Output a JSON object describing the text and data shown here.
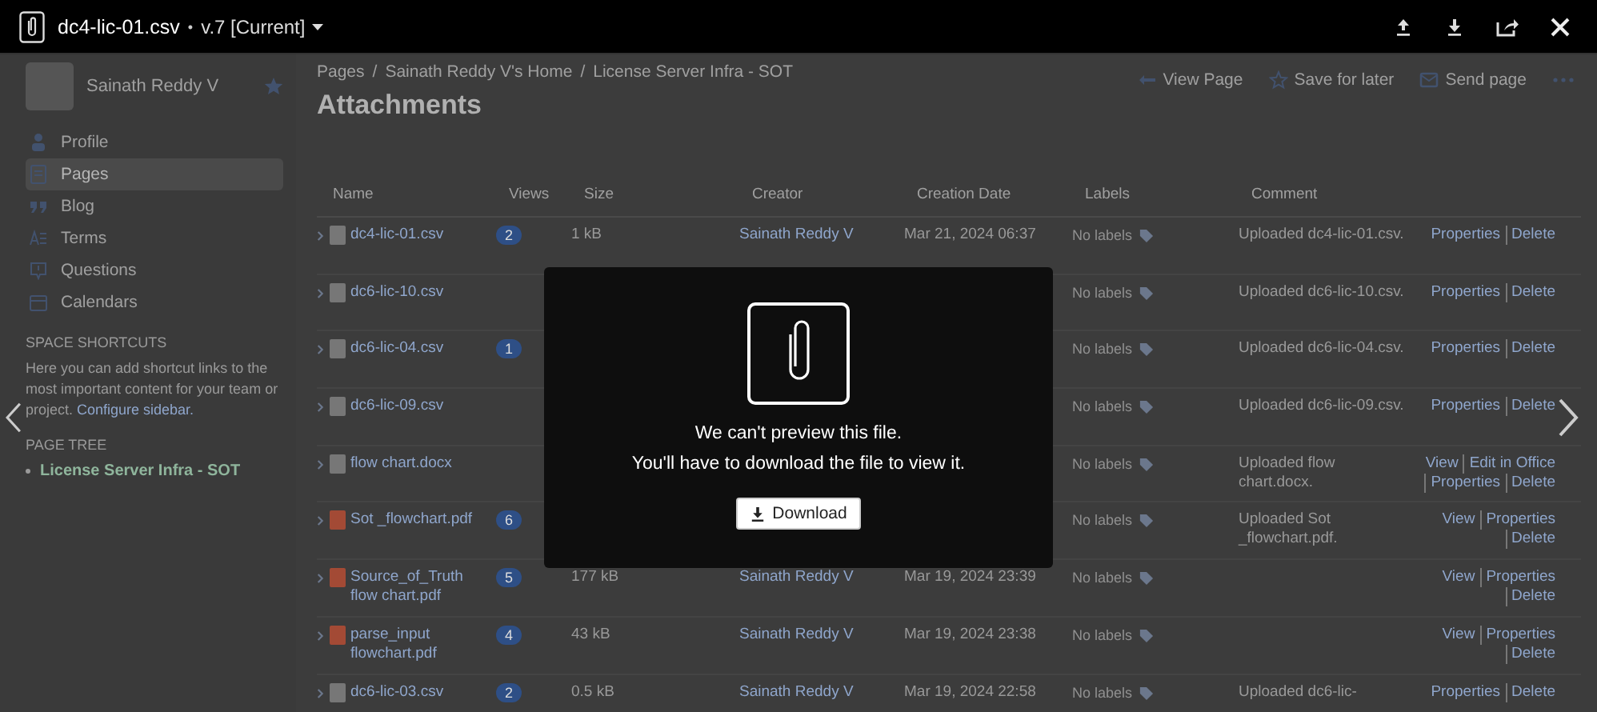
{
  "viewer": {
    "file_name": "dc4-lic-01.csv",
    "separator": "•",
    "version": "v.7 [Current]"
  },
  "preview": {
    "message": "We can't preview this file.",
    "hint": "You'll have to download the file to view it.",
    "button": "Download"
  },
  "page": {
    "sidebar": {
      "user_name": "Sainath Reddy V",
      "nav": [
        {
          "kind": "profile",
          "label": "Profile",
          "selected": false
        },
        {
          "kind": "pages",
          "label": "Pages",
          "selected": true
        },
        {
          "kind": "blog",
          "label": "Blog",
          "selected": false
        },
        {
          "kind": "terms",
          "label": "Terms",
          "selected": false
        },
        {
          "kind": "questions",
          "label": "Questions",
          "selected": false
        },
        {
          "kind": "calendars",
          "label": "Calendars",
          "selected": false
        }
      ],
      "shortcuts_heading": "SPACE SHORTCUTS",
      "shortcuts_text": "Here you can add shortcut links to the most important content for your team or project.",
      "shortcuts_link": "Configure sidebar.",
      "tree_heading": "PAGE TREE",
      "tree": [
        {
          "label": "License Server Infra - SOT"
        }
      ]
    },
    "breadcrumbs": [
      "Pages",
      "Sainath Reddy V's Home",
      "License Server Infra - SOT"
    ],
    "breadcrumb_separator": "/",
    "title": "Attachments",
    "actions": [
      {
        "kind": "view",
        "label": "View Page"
      },
      {
        "kind": "save",
        "label": "Save for later"
      },
      {
        "kind": "send",
        "label": "Send page"
      }
    ],
    "table": {
      "columns": [
        "Name",
        "Views",
        "Size",
        "Creator",
        "Creation Date",
        "Labels",
        "Comment"
      ],
      "rows": [
        {
          "kind": "file",
          "name": "dc4-lic-01.csv",
          "views": "2",
          "size": "1 kB",
          "creator": "Sainath Reddy V",
          "date": "Mar 21, 2024 06:37",
          "labels": "No labels",
          "comment": "Uploaded dc4-lic-01.csv.",
          "actions": [
            "Properties",
            "Delete"
          ]
        },
        {
          "kind": "file",
          "name": "dc6-lic-10.csv",
          "labels": "No labels",
          "comment": "Uploaded dc6-lic-10.csv.",
          "actions": [
            "Properties",
            "Delete"
          ]
        },
        {
          "kind": "file",
          "name": "dc6-lic-04.csv",
          "views": "1",
          "labels": "No labels",
          "comment": "Uploaded dc6-lic-04.csv.",
          "actions": [
            "Properties",
            "Delete"
          ]
        },
        {
          "kind": "file",
          "name": "dc6-lic-09.csv",
          "labels": "No labels",
          "comment": "Uploaded dc6-lic-09.csv.",
          "actions": [
            "Properties",
            "Delete"
          ]
        },
        {
          "kind": "file",
          "name": "flow chart.docx",
          "labels": "No labels",
          "comment": "Uploaded flow chart.docx.",
          "actions": [
            "View",
            "Edit in Office",
            "Properties",
            "Delete"
          ]
        },
        {
          "kind": "pdf",
          "name": "Sot _flowchart.pdf",
          "views": "6",
          "labels": "No labels",
          "comment": "Uploaded Sot _flowchart.pdf.",
          "actions": [
            "View",
            "Properties",
            "Delete"
          ]
        },
        {
          "kind": "pdf",
          "name": "Source_of_Truth flow chart.pdf",
          "views": "5",
          "size": "177 kB",
          "creator": "Sainath Reddy V",
          "date": "Mar 19, 2024 23:39",
          "labels": "No labels",
          "actions": [
            "View",
            "Properties",
            "Delete"
          ]
        },
        {
          "kind": "pdf",
          "name": "parse_input flowchart.pdf",
          "views": "4",
          "size": "43 kB",
          "creator": "Sainath Reddy V",
          "date": "Mar 19, 2024 23:38",
          "labels": "No labels",
          "actions": [
            "View",
            "Properties",
            "Delete"
          ]
        },
        {
          "kind": "file",
          "name": "dc6-lic-03.csv",
          "views": "2",
          "size": "0.5 kB",
          "creator": "Sainath Reddy V",
          "date": "Mar 19, 2024 22:58",
          "labels": "No labels",
          "comment": "Uploaded dc6-lic-",
          "actions": [
            "Properties",
            "Delete"
          ]
        }
      ]
    }
  }
}
